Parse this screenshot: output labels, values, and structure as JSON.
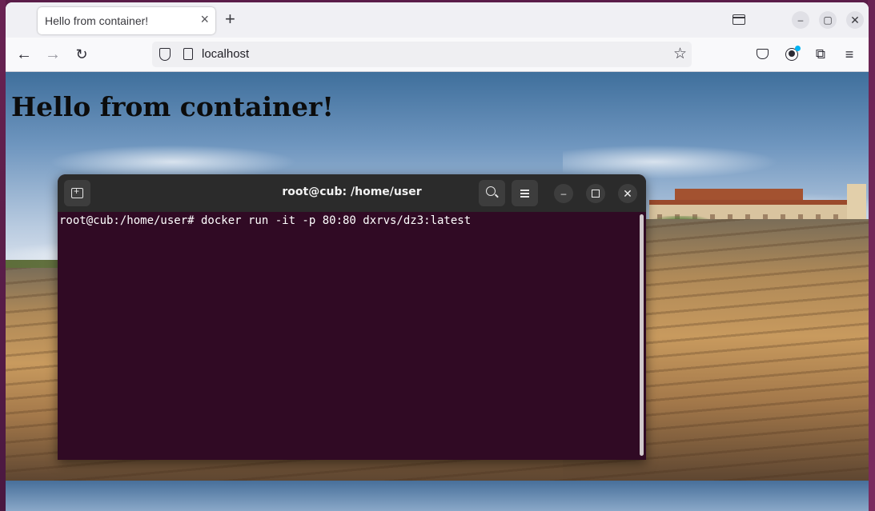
{
  "browser": {
    "tab_title": "Hello from container!",
    "tab_close": "×",
    "new_tab": "+",
    "url": "localhost",
    "window_controls": {
      "minimize": "–",
      "maximize": "▢",
      "close": "✕"
    },
    "icons": [
      "tab-list-icon",
      "back-icon",
      "forward-icon",
      "reload-icon",
      "shield-icon",
      "page-icon",
      "star-icon",
      "pocket-icon",
      "account-icon",
      "extensions-icon",
      "menu-icon"
    ]
  },
  "page": {
    "heading": "Hello from container!"
  },
  "terminal": {
    "title": "root@cub: /home/user",
    "prompt_line": "root@cub:/home/user# docker run -it -p 80:80 dxrvs/dz3:latest",
    "controls": {
      "minimize": "–",
      "close": "✕"
    },
    "background": "#300a24"
  }
}
